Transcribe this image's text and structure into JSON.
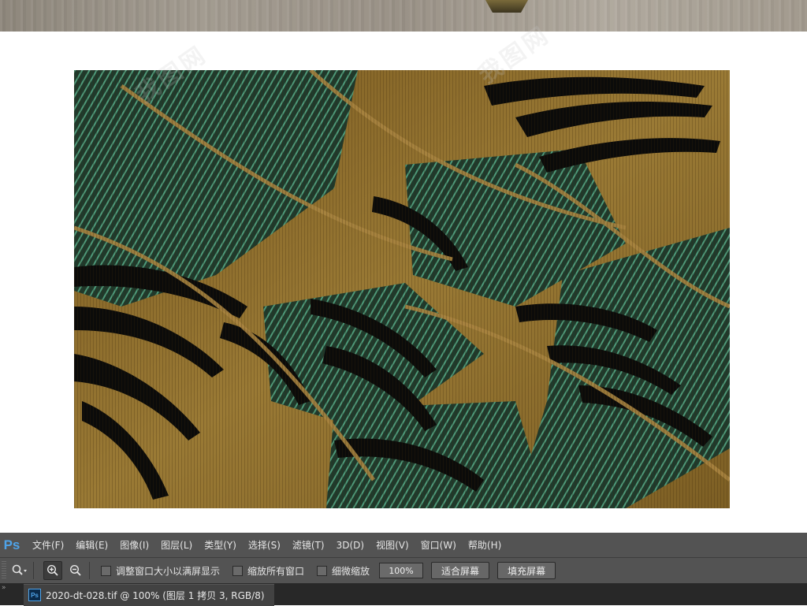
{
  "app": {
    "logo": "Ps",
    "menu": [
      "文件(F)",
      "编辑(E)",
      "图像(I)",
      "图层(L)",
      "类型(Y)",
      "选择(S)",
      "滤镜(T)",
      "3D(D)",
      "视图(V)",
      "窗口(W)",
      "帮助(H)"
    ]
  },
  "options_bar": {
    "tool_icon": "zoom-icon",
    "zoom_in_icon": "zoom-in-icon",
    "zoom_out_icon": "zoom-out-icon",
    "checkboxes": [
      {
        "label": "调整窗口大小以满屏显示",
        "checked": false
      },
      {
        "label": "缩放所有窗口",
        "checked": false
      },
      {
        "label": "细微缩放",
        "checked": false
      }
    ],
    "zoom_value": "100%",
    "fit_screen_label": "适合屏幕",
    "fill_screen_label": "填充屏幕"
  },
  "document": {
    "icon": "Ps",
    "tab_title": "2020-dt-028.tif @ 100% (图层 1 拷贝 3, RGB/8)"
  },
  "artwork": {
    "subject": "gold palm leaves over dark green",
    "colors": {
      "gold": "#8a6a2a",
      "dark_green": "#1f3a2c",
      "teal": "#4e9a7a",
      "black": "#0b0b0a"
    }
  }
}
